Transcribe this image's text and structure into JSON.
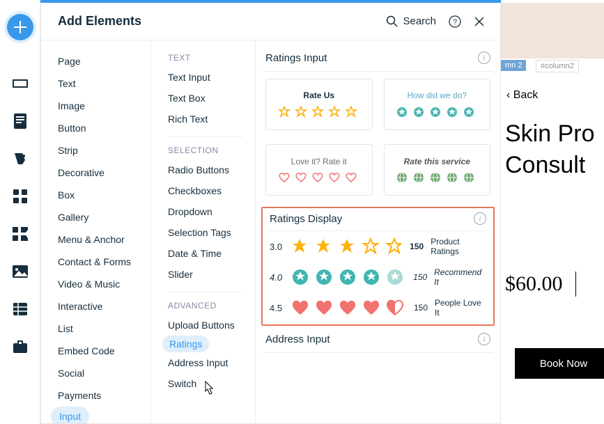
{
  "header": {
    "title": "Add Elements",
    "search_label": "Search"
  },
  "sidebar_categories": [
    "Page",
    "Text",
    "Image",
    "Button",
    "Strip",
    "Decorative",
    "Box",
    "Gallery",
    "Menu & Anchor",
    "Contact & Forms",
    "Video & Music",
    "Interactive",
    "List",
    "Embed Code",
    "Social",
    "Payments",
    "Input"
  ],
  "input_subcategories": {
    "text_header": "TEXT",
    "text_items": [
      "Text Input",
      "Text Box",
      "Rich Text"
    ],
    "selection_header": "SELECTION",
    "selection_items": [
      "Radio Buttons",
      "Checkboxes",
      "Dropdown",
      "Selection Tags",
      "Date & Time",
      "Slider"
    ],
    "advanced_header": "ADVANCED",
    "advanced_items": [
      "Upload Buttons",
      "Ratings",
      "Address Input",
      "Switch"
    ]
  },
  "ratings_input": {
    "section_title": "Ratings Input",
    "cards": [
      {
        "title": "Rate Us"
      },
      {
        "title": "How did we do?"
      },
      {
        "title": "Love it? Rate it"
      },
      {
        "title": "Rate this service"
      }
    ]
  },
  "ratings_display": {
    "section_title": "Ratings Display",
    "rows": [
      {
        "score": "3.0",
        "count": "150",
        "label": "Product Ratings"
      },
      {
        "score": "4.0",
        "count": "150",
        "label": "Recommend It"
      },
      {
        "score": "4.5",
        "count": "150",
        "label": "People Love It"
      }
    ]
  },
  "address_input": {
    "section_title": "Address Input"
  },
  "canvas": {
    "tag1": "mn 2",
    "tag2": "#column2",
    "back": "Back",
    "title_l1": "Skin Pro",
    "title_l2": "Consult",
    "price": "$60.00",
    "book": "Book Now"
  },
  "colors": {
    "star_gold": "#FDB10C",
    "star_teal": "#4EB7B3",
    "heart_pink": "#F2726F",
    "globe_green": "#6FA86F"
  }
}
